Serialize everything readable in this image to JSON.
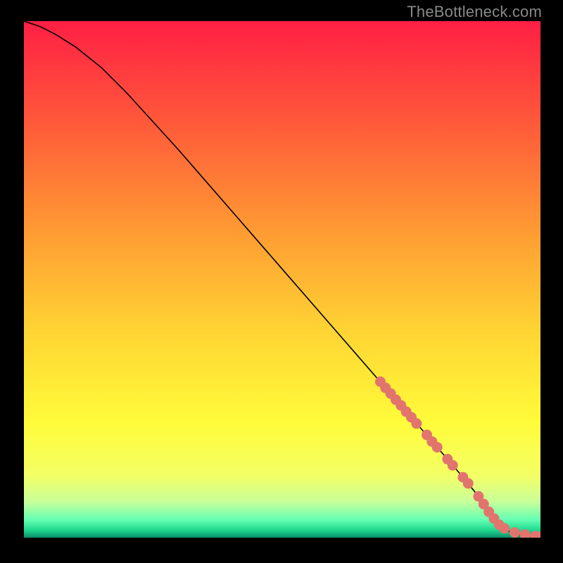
{
  "watermark": "TheBottleneck.com",
  "chart_data": {
    "type": "line",
    "title": "",
    "xlabel": "",
    "ylabel": "",
    "xlim": [
      0,
      100
    ],
    "ylim": [
      0,
      100
    ],
    "grid": false,
    "series": [
      {
        "name": "curve",
        "type": "line",
        "color": "#000000",
        "x": [
          0,
          3,
          6,
          10,
          15,
          20,
          30,
          40,
          50,
          60,
          70,
          75,
          80,
          85,
          88,
          90,
          92,
          94,
          96,
          98,
          100
        ],
        "y": [
          100,
          99,
          97.5,
          95,
          91,
          86,
          75,
          63.5,
          52,
          40.5,
          29,
          23.3,
          17.5,
          11.7,
          8,
          5,
          2.5,
          1.2,
          0.6,
          0.3,
          0.2
        ]
      },
      {
        "name": "markers",
        "type": "scatter",
        "color": "#e2746e",
        "x": [
          69,
          70,
          71,
          72,
          73,
          74,
          75,
          76,
          78,
          79,
          80,
          82,
          83,
          85,
          86,
          88,
          89,
          90,
          91,
          92,
          93,
          95,
          97,
          99,
          100
        ],
        "y": [
          30.2,
          29.0,
          27.9,
          26.7,
          25.6,
          24.4,
          23.3,
          22.1,
          19.9,
          18.6,
          17.5,
          15.2,
          14.0,
          11.7,
          10.5,
          8.0,
          6.5,
          5.0,
          3.7,
          2.5,
          1.8,
          1.0,
          0.6,
          0.3,
          0.2
        ]
      }
    ],
    "background_gradient": {
      "stops": [
        {
          "offset": 0.0,
          "color": "#ff1f44"
        },
        {
          "offset": 0.2,
          "color": "#ff5a3a"
        },
        {
          "offset": 0.4,
          "color": "#ff9933"
        },
        {
          "offset": 0.6,
          "color": "#ffd433"
        },
        {
          "offset": 0.78,
          "color": "#fffc3a"
        },
        {
          "offset": 0.88,
          "color": "#f3ff66"
        },
        {
          "offset": 0.93,
          "color": "#c9ff99"
        },
        {
          "offset": 0.965,
          "color": "#66ffb3"
        },
        {
          "offset": 0.985,
          "color": "#1fd98f"
        },
        {
          "offset": 1.0,
          "color": "#0a8f6b"
        }
      ]
    }
  }
}
